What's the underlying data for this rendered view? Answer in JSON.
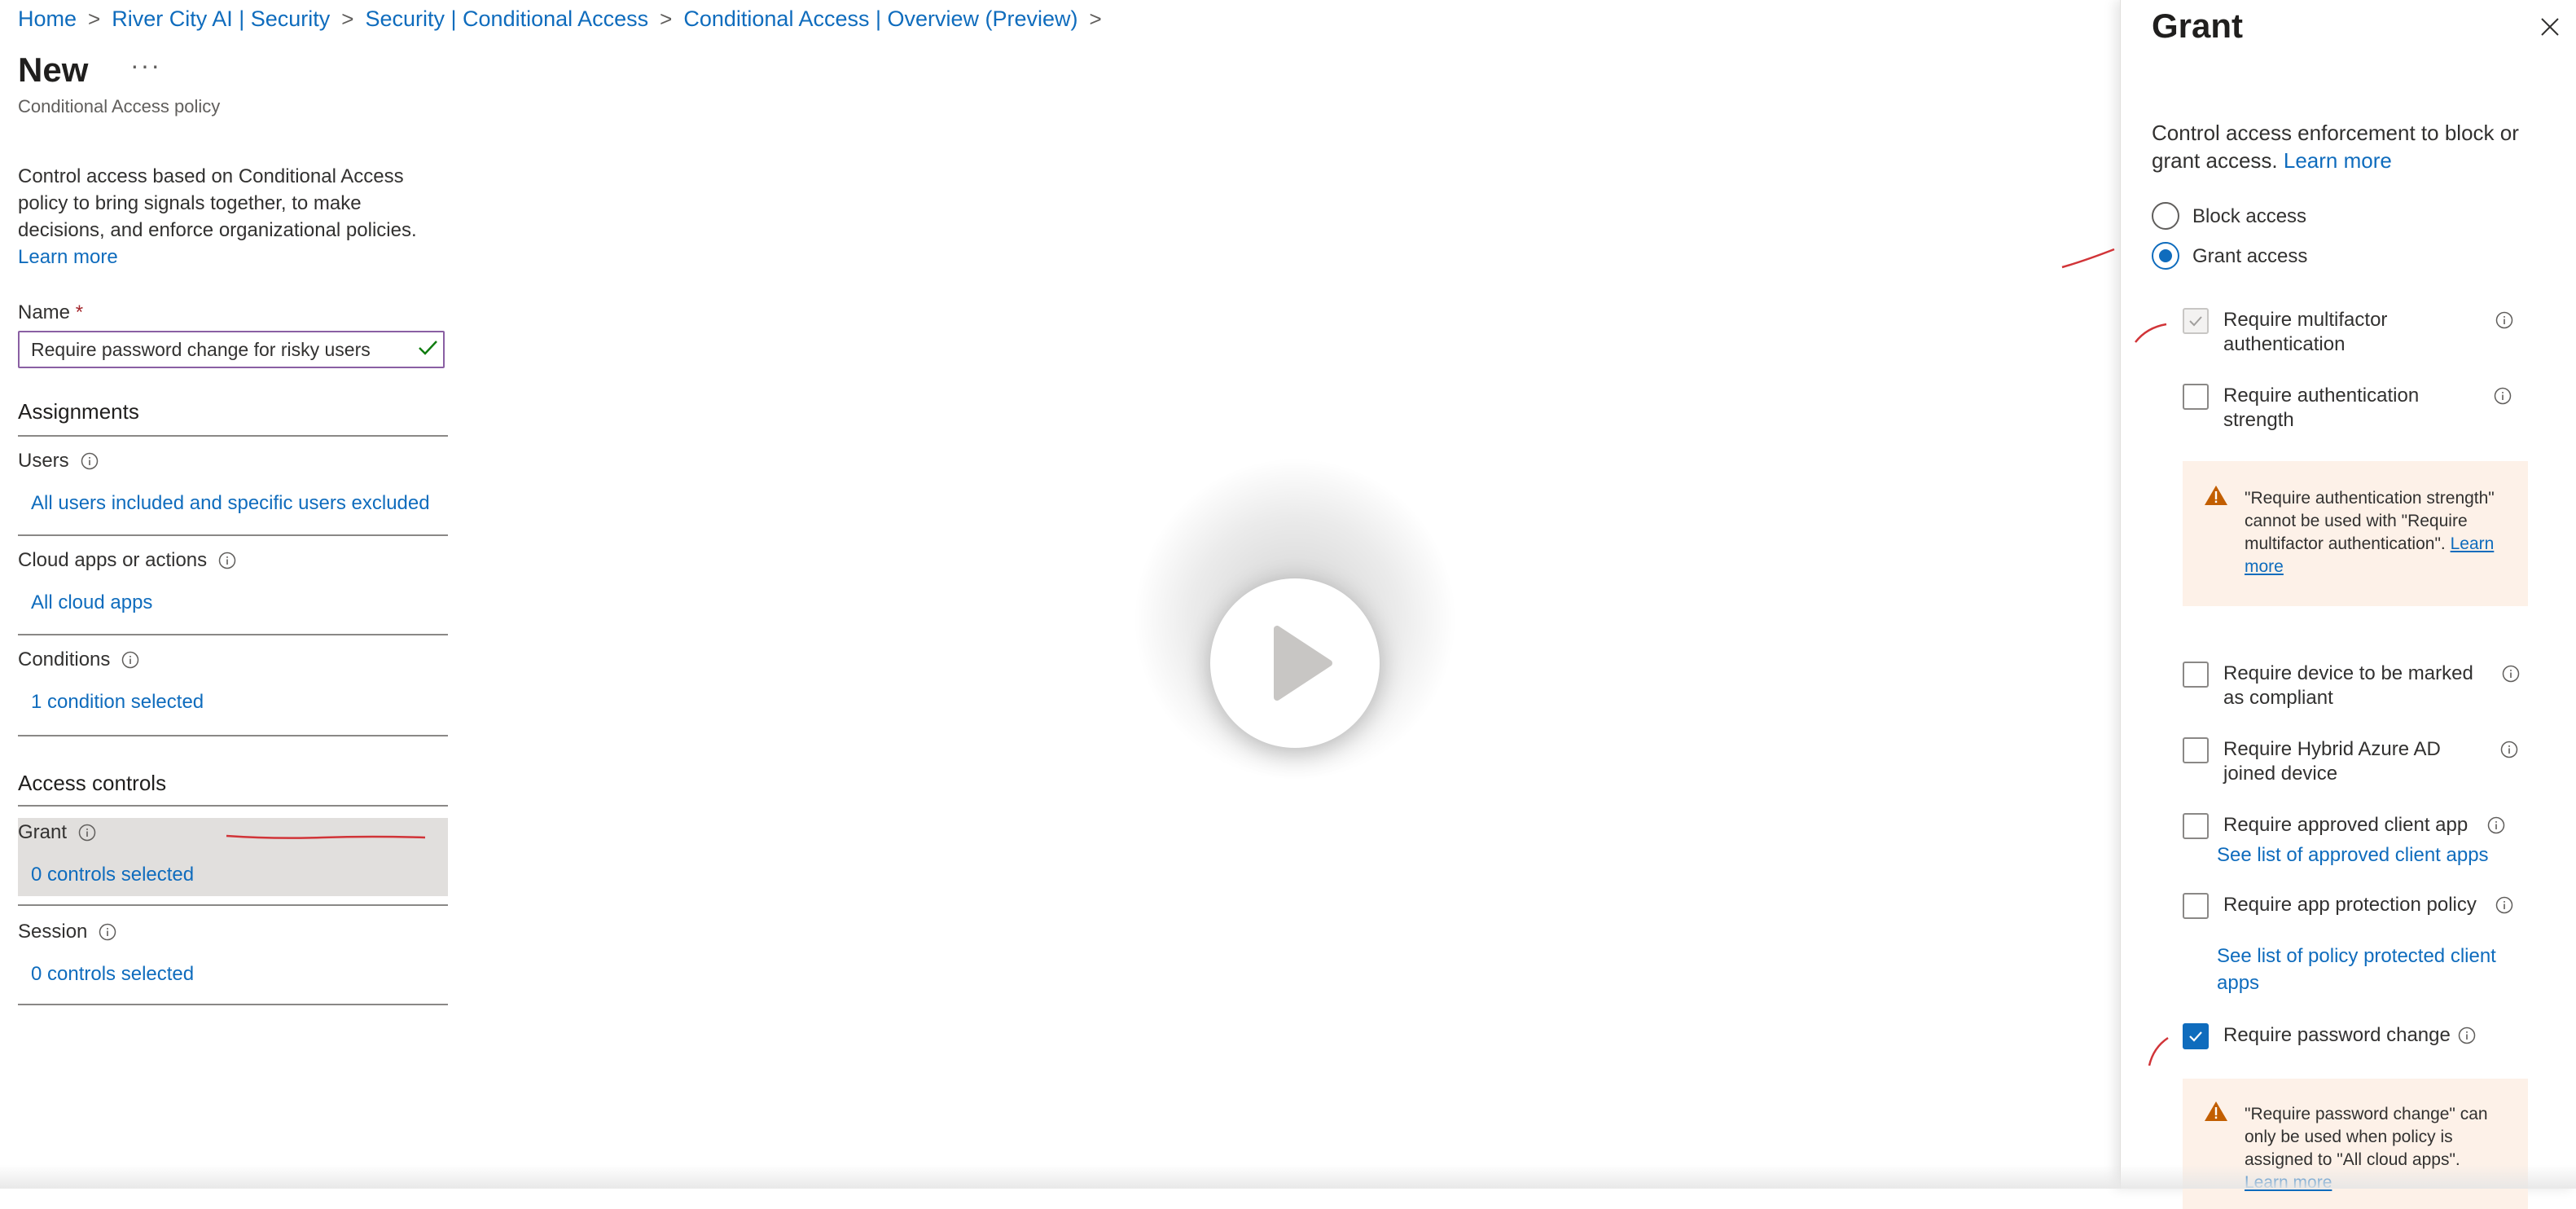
{
  "breadcrumb": [
    "Home",
    "River City AI | Security",
    "Security | Conditional Access",
    "Conditional Access | Overview (Preview)"
  ],
  "page": {
    "title": "New",
    "more_label": "···",
    "subtitle": "Conditional Access policy",
    "intro": "Control access based on Conditional Access policy to bring signals together, to make decisions, and enforce organizational policies.",
    "intro_link": "Learn more",
    "name_label": "Name",
    "name_required": "*",
    "name_value": "Require password change for risky users"
  },
  "assignments": {
    "heading": "Assignments",
    "users_label": "Users",
    "users_value": "All users included and specific users excluded",
    "cloud_label": "Cloud apps or actions",
    "cloud_value": "All cloud apps",
    "conditions_label": "Conditions",
    "conditions_value": "1 condition selected"
  },
  "access_controls": {
    "heading": "Access controls",
    "grant_label": "Grant",
    "grant_value": "0 controls selected",
    "session_label": "Session",
    "session_value": "0 controls selected"
  },
  "panel": {
    "title": "Grant",
    "description": "Control access enforcement to block or grant access.",
    "description_link": "Learn more",
    "block_label": "Block access",
    "grant_label": "Grant access",
    "selected_option": "Grant access",
    "options": [
      {
        "label": "Require multifactor authentication",
        "state": "disabled-checked"
      },
      {
        "label": "Require authentication strength",
        "state": "unchecked"
      },
      {
        "label": "Require device to be marked as compliant",
        "state": "unchecked"
      },
      {
        "label": "Require Hybrid Azure AD joined device",
        "state": "unchecked"
      },
      {
        "label": "Require approved client app",
        "state": "unchecked"
      },
      {
        "label": "Require app protection policy",
        "state": "unchecked"
      },
      {
        "label": "Require password change",
        "state": "checked"
      }
    ],
    "approved_apps_link": "See list of approved client apps",
    "policy_apps_link": "See list of policy protected client apps",
    "warning_strength": "\"Require authentication strength\" cannot be used with \"Require multifactor authentication\".",
    "warning_strength_link": "Learn more",
    "warning_password": "\"Require password change\" can only be used when policy is assigned to \"All cloud apps\".",
    "warning_password_link": "Learn more"
  },
  "colors": {
    "link": "#0f6cbd",
    "accent": "#0f6cbd",
    "warning_bg": "#fdf1e8",
    "annotation": "#d13438"
  },
  "overlay": {
    "icon": "play-icon"
  }
}
